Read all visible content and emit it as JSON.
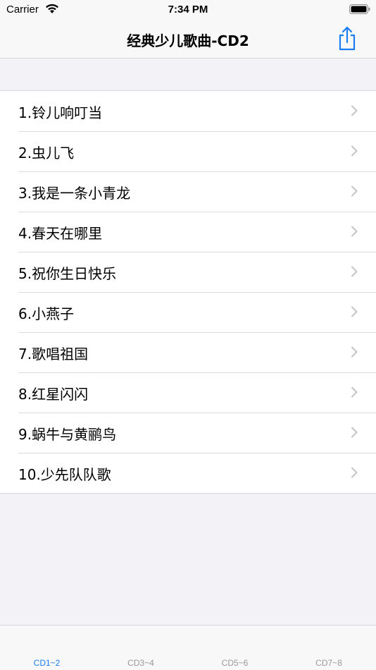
{
  "status_bar": {
    "carrier": "Carrier",
    "time": "7:34 PM"
  },
  "nav": {
    "title": "经典少儿歌曲-CD2",
    "share_icon": "share-icon"
  },
  "songs": [
    "1.铃儿响叮当",
    "2.虫儿飞",
    "3.我是一条小青龙",
    "4.春天在哪里",
    "5.祝你生日快乐",
    "6.小燕子",
    "7.歌唱祖国",
    "8.红星闪闪",
    "9.蜗牛与黄鹂鸟",
    "10.少先队队歌"
  ],
  "tabs": [
    {
      "label": "CD1~2",
      "active": true
    },
    {
      "label": "CD3~4",
      "active": false
    },
    {
      "label": "CD5~6",
      "active": false
    },
    {
      "label": "CD7~8",
      "active": false
    }
  ],
  "colors": {
    "accent": "#1a7ef0",
    "inactive_tab": "#999999",
    "chevron": "#c4c4c7"
  }
}
